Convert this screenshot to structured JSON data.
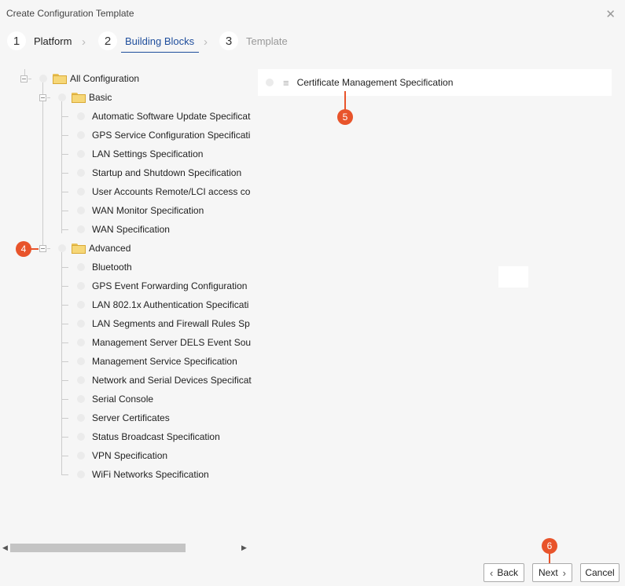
{
  "dialog": {
    "title": "Create Configuration Template"
  },
  "steps": [
    {
      "num": "1",
      "label": "Platform"
    },
    {
      "num": "2",
      "label": "Building Blocks"
    },
    {
      "num": "3",
      "label": "Template"
    }
  ],
  "tree": {
    "root": "All Configuration",
    "basic": {
      "label": "Basic",
      "items": [
        "Automatic Software Update Specificat",
        "GPS Service Configuration Specificati",
        "LAN Settings Specification",
        "Startup and Shutdown Specification",
        "User Accounts Remote/LCI access co",
        "WAN Monitor Specification",
        "WAN Specification"
      ]
    },
    "advanced": {
      "label": "Advanced",
      "items": [
        "Bluetooth",
        "GPS Event Forwarding Configuration",
        "LAN 802.1x Authentication Specificati",
        "LAN Segments and Firewall Rules Sp",
        "Management Server DELS Event Sou",
        "Management Service Specification",
        "Network and Serial Devices Specificat",
        "Serial Console",
        "Server Certificates",
        "Status Broadcast Specification",
        "VPN Specification",
        "WiFi Networks Specification"
      ]
    }
  },
  "selected": {
    "items": [
      "Certificate Management Specification"
    ]
  },
  "badges": {
    "b4": "4",
    "b5": "5",
    "b6": "6"
  },
  "buttons": {
    "back": "Back",
    "next": "Next",
    "cancel": "Cancel"
  },
  "colors": {
    "accent": "#1f4e9c",
    "badge": "#e8542b"
  }
}
